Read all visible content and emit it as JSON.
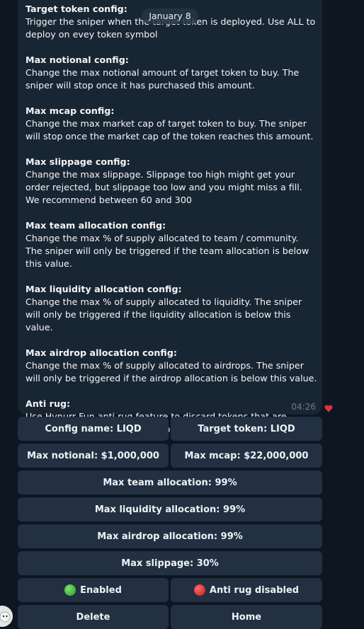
{
  "date": "January 8",
  "message": {
    "sections": [
      {
        "title": "Target token config:",
        "body": "Trigger the sniper when the target token is deployed. Use ALL to deploy on evey token symbol"
      },
      {
        "title": "Max notional config:",
        "body": "Change the max notional amount of target token to buy. The sniper will stop once it has purchased this amount."
      },
      {
        "title": "Max mcap config:",
        "body": "Change the max market cap of target token to buy. The sniper will stop once the market cap of the token reaches this amount."
      },
      {
        "title": "Max slippage config:",
        "body": "Change the max slippage. Slippage too high might get your order rejected, but slippage too low and you might miss a fill. We recommend between 60 and 300"
      },
      {
        "title": "Max team allocation config:",
        "body": "Change the max % of supply allocated to team / community. The sniper will only be triggered if the team allocation is below this value."
      },
      {
        "title": "Max liquidity allocation config:",
        "body": "Change the max % of supply allocated to liquidity. The sniper will only be triggered if the liquidity allocation is below this value."
      },
      {
        "title": "Max airdrop allocation config:",
        "body": "Change the max % of supply allocated to airdrops. The sniper will only be triggered if the airdrop allocation is below this value."
      },
      {
        "title": "Anti rug:",
        "body": "Use Hypurr Fun anti rug feature to discard tokens that are deemed likely to rug by the Hypurr Fun Team."
      }
    ],
    "time": "04:26",
    "reaction": "heart"
  },
  "keyboard": {
    "config_name": "Config name: LIQD",
    "target_token": "Target token: LIQD",
    "max_notional": "Max notional: $1,000,000",
    "max_mcap": "Max mcap: $22,000,000",
    "max_team": "Max team allocation: 99%",
    "max_liquidity": "Max liquidity allocation: 99%",
    "max_airdrop": "Max airdrop allocation: 99%",
    "max_slippage": "Max slippage: 30%",
    "enabled": "Enabled",
    "anti_rug": "Anti rug disabled",
    "delete": "Delete",
    "home": "Home"
  },
  "colors": {
    "background": "#0e1621",
    "bubble": "#182533",
    "button": "#223042",
    "enabled_dot": "#2f9a26",
    "disabled_dot": "#c51616",
    "heart": "#e0303a"
  }
}
